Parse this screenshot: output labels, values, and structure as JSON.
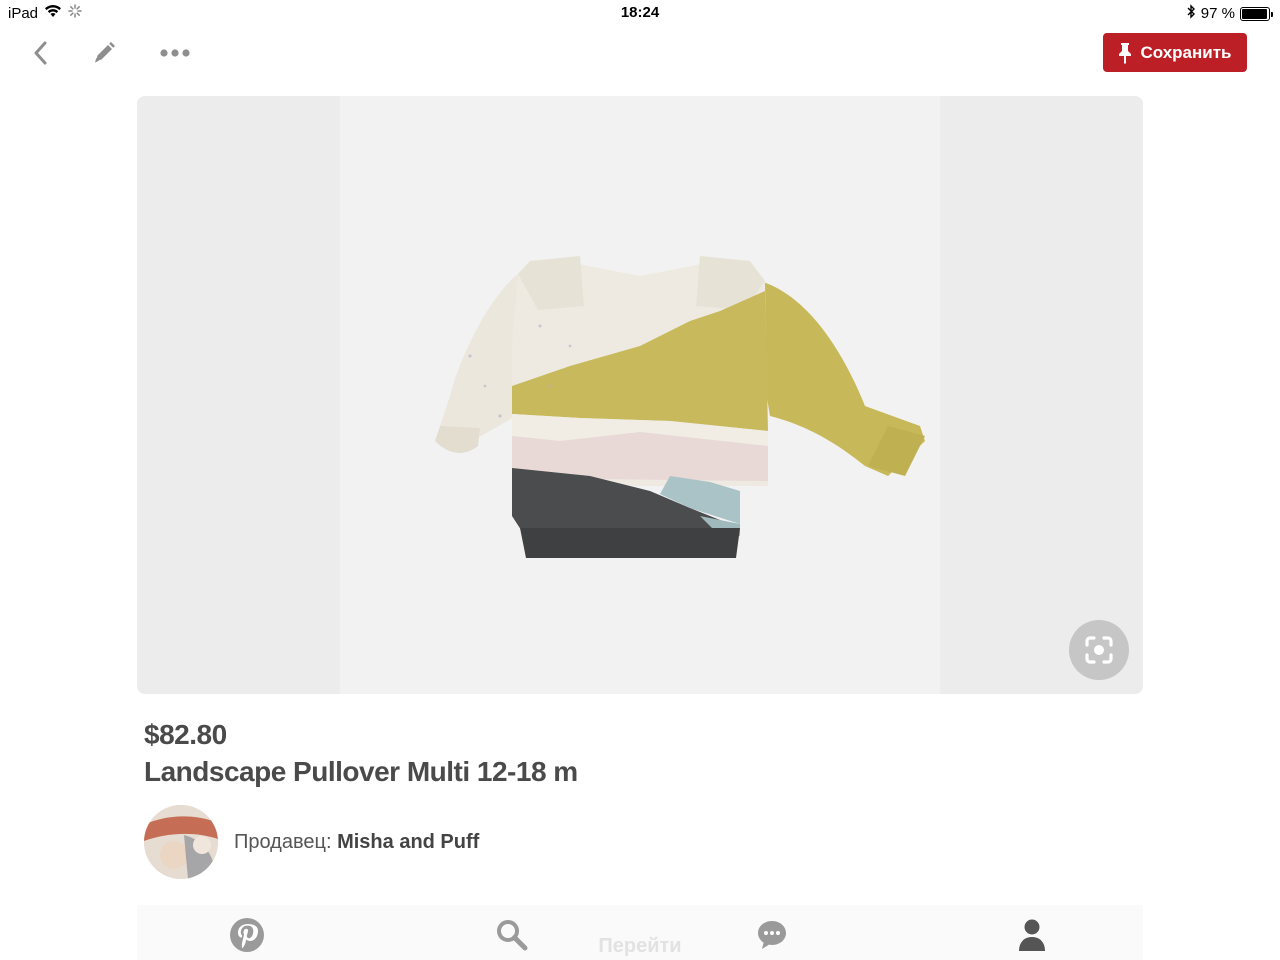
{
  "status_bar": {
    "device": "iPad",
    "time": "18:24",
    "battery": "97 %",
    "battery_level": 0.97
  },
  "toolbar": {
    "back_icon": "chevron-left-icon",
    "edit_icon": "pencil-icon",
    "more_icon": "more-dots-icon",
    "save_label": "Сохранить",
    "save_color": "#bd1f26"
  },
  "product": {
    "price": "$82.80",
    "title": "Landscape Pullover Multi 12-18 m",
    "seller_prefix": "Продавец:",
    "seller_name": "Misha and Puff"
  },
  "tabbar": {
    "tabs": [
      {
        "icon": "pinterest-logo-icon"
      },
      {
        "icon": "search-icon"
      },
      {
        "icon": "chat-bubble-icon"
      },
      {
        "icon": "profile-icon"
      }
    ],
    "goto_label": "Перейти"
  }
}
